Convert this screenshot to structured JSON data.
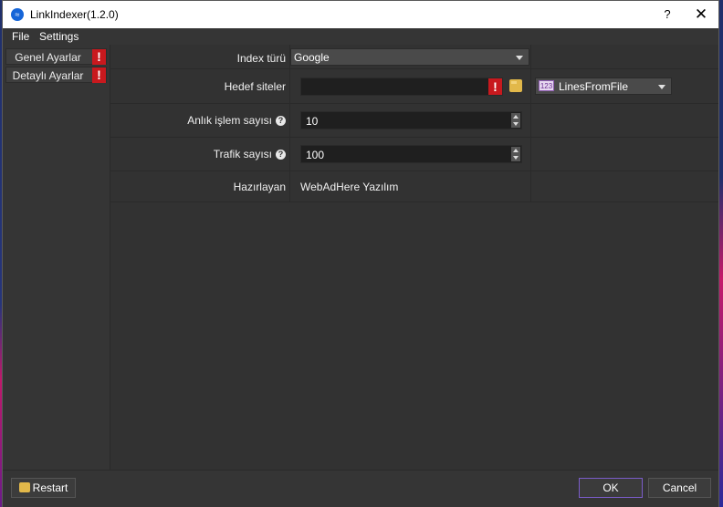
{
  "window": {
    "title": "LinkIndexer(1.2.0)",
    "help": "?",
    "close": "✕"
  },
  "menu": {
    "file": "File",
    "settings": "Settings"
  },
  "sidebar": {
    "items": [
      {
        "label": "Genel Ayarlar",
        "warning": "!"
      },
      {
        "label": "Detaylı Ayarlar",
        "warning": "!"
      }
    ]
  },
  "grid": {
    "index_turu": {
      "label": "Index türü",
      "value": "Google"
    },
    "hedef_siteler": {
      "label": "Hedef siteler",
      "value": "",
      "warning": "!",
      "source_icon": "123",
      "source": "LinesFromFile"
    },
    "anlik_islem": {
      "label": "Anlık işlem sayısı",
      "help": "?",
      "value": "10"
    },
    "trafik": {
      "label": "Trafik sayısı",
      "help": "?",
      "value": "100"
    },
    "hazirlayan": {
      "label": "Hazırlayan",
      "value": "WebAdHere Yazılım"
    }
  },
  "footer": {
    "restart": "Restart",
    "ok": "OK",
    "cancel": "Cancel"
  },
  "colors": {
    "warning": "#c8191e",
    "ok_border": "#7b5cc9",
    "background": "#353535"
  }
}
